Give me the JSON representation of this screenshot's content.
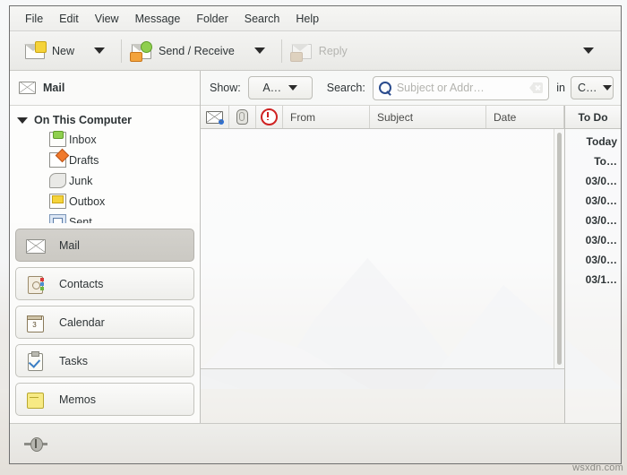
{
  "menubar": {
    "items": [
      {
        "label": "File"
      },
      {
        "label": "Edit"
      },
      {
        "label": "View"
      },
      {
        "label": "Message"
      },
      {
        "label": "Folder"
      },
      {
        "label": "Search"
      },
      {
        "label": "Help"
      }
    ]
  },
  "toolbar": {
    "new_label": "New",
    "new_icon": "new-message-icon",
    "send_receive_label": "Send / Receive",
    "send_receive_icon": "send-receive-icon",
    "reply_label": "Reply",
    "reply_icon": "reply-icon",
    "reply_disabled": true
  },
  "sidebar": {
    "header_label": "Mail",
    "header_icon": "envelope-icon",
    "tree_root": "On This Computer",
    "folders": [
      {
        "label": "Inbox",
        "icon": "inbox-icon"
      },
      {
        "label": "Drafts",
        "icon": "drafts-icon"
      },
      {
        "label": "Junk",
        "icon": "junk-icon"
      },
      {
        "label": "Outbox",
        "icon": "outbox-icon"
      },
      {
        "label": "Sent",
        "icon": "sent-icon"
      }
    ],
    "switcher": [
      {
        "label": "Mail",
        "icon": "mail-icon",
        "active": true
      },
      {
        "label": "Contacts",
        "icon": "contacts-icon",
        "active": false
      },
      {
        "label": "Calendar",
        "icon": "calendar-icon",
        "active": false,
        "day": "3"
      },
      {
        "label": "Tasks",
        "icon": "tasks-icon",
        "active": false
      },
      {
        "label": "Memos",
        "icon": "memos-icon",
        "active": false
      }
    ]
  },
  "searchbar": {
    "show_label": "Show:",
    "show_value": "A…",
    "search_label": "Search:",
    "search_value": "",
    "search_placeholder": "Subject or Addr…",
    "clear_icon": "clear-icon",
    "search_icon": "search-icon",
    "in_label": "in",
    "scope_value": "C…"
  },
  "messagelist": {
    "columns": [
      {
        "label": "",
        "icon": "read-status-icon",
        "key": "status"
      },
      {
        "label": "",
        "icon": "paperclip-icon",
        "key": "attachment"
      },
      {
        "label": "",
        "icon": "importance-icon",
        "key": "important"
      },
      {
        "label": "From",
        "key": "from"
      },
      {
        "label": "Subject",
        "key": "subject"
      },
      {
        "label": "Date",
        "key": "date"
      }
    ],
    "rows": []
  },
  "todo": {
    "header": "To Do",
    "items": [
      {
        "label": "Today"
      },
      {
        "label": "To…"
      },
      {
        "label": "03/0…"
      },
      {
        "label": "03/0…"
      },
      {
        "label": "03/0…"
      },
      {
        "label": "03/0…"
      },
      {
        "label": "03/0…"
      },
      {
        "label": "03/1…"
      }
    ]
  },
  "statusbar": {
    "network_icon": "network-status-icon",
    "text": ""
  },
  "watermark": "wsxdn.com",
  "colors": {
    "accent": "#2a4b8d",
    "important": "#cf2222",
    "unread_dot": "#2f6fd0",
    "window_border": "#6f6f6f"
  }
}
